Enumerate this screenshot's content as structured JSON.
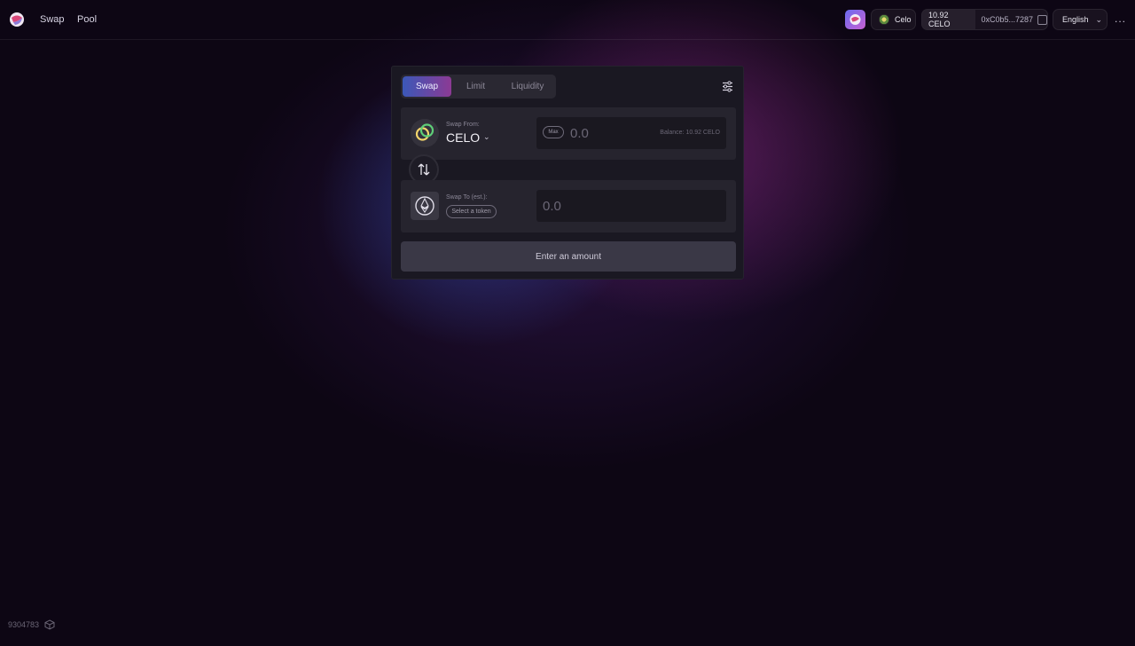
{
  "header": {
    "nav": [
      {
        "label": "Swap"
      },
      {
        "label": "Pool"
      }
    ],
    "network_label": "Celo",
    "balance": "10.92 CELO",
    "address": "0xC0b5...7287",
    "language": "English",
    "more": "..."
  },
  "swap_card": {
    "tabs": [
      {
        "label": "Swap"
      },
      {
        "label": "Limit"
      },
      {
        "label": "Liquidity"
      }
    ],
    "from": {
      "label": "Swap From:",
      "token": "CELO",
      "max_label": "Max",
      "amount_placeholder": "0.0",
      "balance": "Balance: 10.92 CELO"
    },
    "to": {
      "label": "Swap To (est.):",
      "select_label": "Select a token",
      "amount_placeholder": "0.0"
    },
    "submit_label": "Enter an amount"
  },
  "footer": {
    "block_number": "9304783"
  },
  "colors": {
    "background": "#0d0614",
    "accent_gradient_start": "#3b58b8",
    "accent_gradient_end": "#8c3a94"
  },
  "icons": [
    "logo-icon",
    "app-icon",
    "celo-network-icon",
    "address-icon",
    "chevron-down-icon",
    "settings-icon",
    "celo-token-icon",
    "switch-arrows-icon",
    "eth-token-icon",
    "cube-icon"
  ]
}
